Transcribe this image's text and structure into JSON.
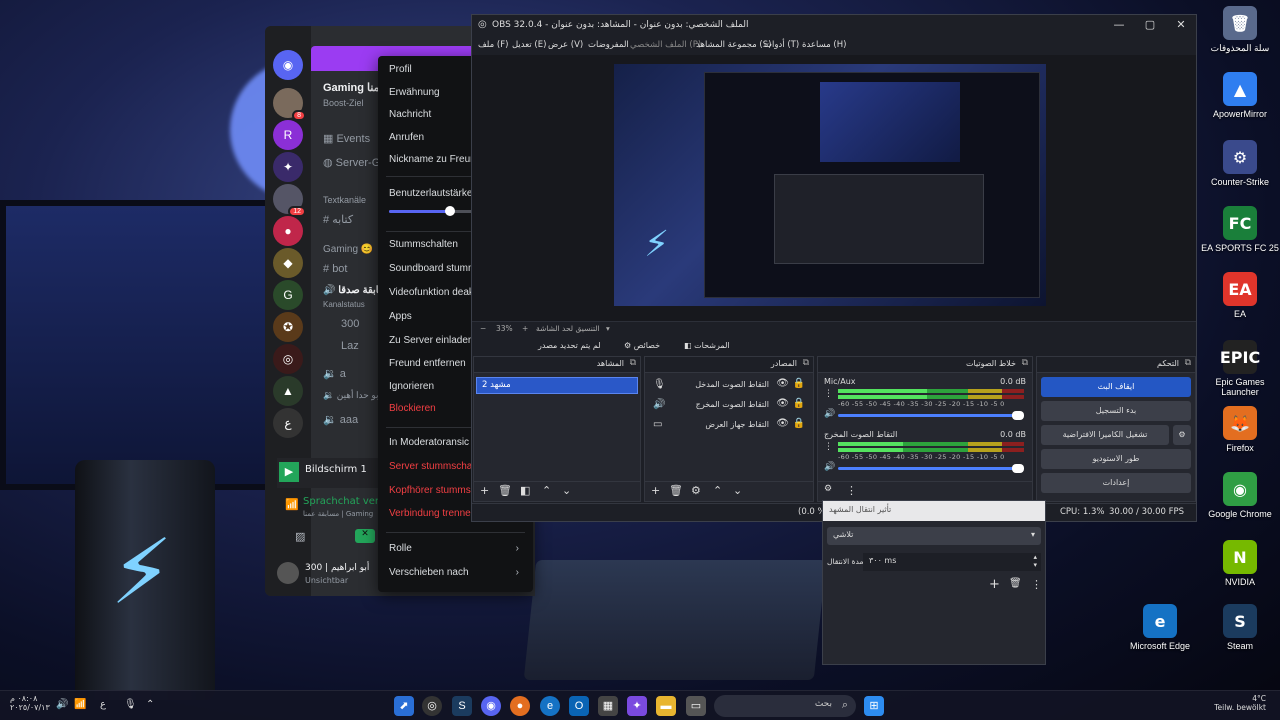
{
  "desktop": {
    "icons": [
      {
        "label": "سلة المحذوفات",
        "glyph": "🗑",
        "color": "#5a6a8c"
      },
      {
        "label": "ApowerMirror",
        "glyph": "▲",
        "color": "#2f7ef0"
      },
      {
        "label": "Counter-Strike",
        "glyph": "⚙",
        "color": "#3a4a8c"
      },
      {
        "label": "EA SPORTS FC 25",
        "glyph": "FC",
        "color": "#1a7f3a"
      },
      {
        "label": "EA",
        "glyph": "EA",
        "color": "#e0352b"
      },
      {
        "label": "Epic Games Launcher",
        "glyph": "EPIC",
        "color": "#222"
      },
      {
        "label": "Firefox",
        "glyph": "🦊",
        "color": "#e36e20"
      },
      {
        "label": "Google Chrome",
        "glyph": "◉",
        "color": "#2f9e44"
      },
      {
        "label": "NVIDIA",
        "glyph": "N",
        "color": "#76b900"
      },
      {
        "label": "Microsoft Edge",
        "glyph": "e",
        "color": "#1572c4"
      },
      {
        "label": "Steam",
        "glyph": "S",
        "color": "#1b3b5e"
      }
    ]
  },
  "discord": {
    "server_name": "Gaming صدقة عمنا",
    "boost_label": "Boost-Ziel",
    "channels": [
      "Events",
      "Server-G",
      "Textkanäle",
      "كتابه",
      "Gaming 😊",
      "bot",
      "مسابقة صدقا",
      "Kanalstatus",
      "300",
      "Laz",
      "a",
      "أبو حدا أهين",
      "aaa"
    ],
    "voice_user": "Bildschirm 1",
    "voice_status": "Sprachchat verb",
    "voice_server": "مسابقة عمنا | Gaming",
    "user_name": "أبو ابراهيم | 300",
    "user_status": "Unsichtbar",
    "badges": [
      "8",
      "12"
    ]
  },
  "context_menu": {
    "items": [
      {
        "label": "Profil",
        "red": false
      },
      {
        "label": "Erwähnung",
        "red": false
      },
      {
        "label": "Nachricht",
        "red": false
      },
      {
        "label": "Anrufen",
        "red": false
      },
      {
        "label": "Nickname zu Freund",
        "red": false
      },
      {
        "label": "Benutzerlautstärke",
        "red": false
      },
      {
        "label": "Stummschalten",
        "red": false
      },
      {
        "label": "Soundboard stumm",
        "red": false
      },
      {
        "label": "Videofunktion deakt",
        "red": false
      },
      {
        "label": "Apps",
        "red": false
      },
      {
        "label": "Zu Server einladen",
        "red": false
      },
      {
        "label": "Freund entfernen",
        "red": false
      },
      {
        "label": "Ignorieren",
        "red": false
      },
      {
        "label": "Blockieren",
        "red": true
      },
      {
        "label": "In Moderatoransic",
        "red": false
      },
      {
        "label": "Server stummschalt",
        "red": true
      },
      {
        "label": "Kopfhörer stummsch",
        "red": true
      },
      {
        "label": "Verbindung trennen",
        "red": true
      },
      {
        "label": "Rolle",
        "red": false
      },
      {
        "label": "Verschieben nach",
        "red": false
      }
    ],
    "volume_level": 0.55
  },
  "obs": {
    "title": "OBS 32.0.4 - الملف الشخصي: بدون عنوان - المشاهد: بدون عنوان",
    "menu": [
      "ملف (F)",
      "تعديل (E)",
      "عرض (V)",
      "المفروضات",
      "الملف الشخصي (P)",
      "مجموعة المشاهد (S)",
      "أدوات (T)",
      "مساعدة (H)"
    ],
    "zoom": "33%",
    "zoom_hint": "التنسيق لحد الشاشة",
    "toolbar": {
      "no_source": "لم يتم تحديد مصدر",
      "properties": "خصائص",
      "filters": "المرشحات"
    },
    "docks": {
      "scenes": "المشاهد",
      "sources": "المصادر",
      "mixer": "خلاط الصوتيات",
      "controls": "التحكم"
    },
    "scene_selected": "مشهد 2",
    "sources": [
      {
        "name": "التقاط الصوت المدخل",
        "icon": "🎙"
      },
      {
        "name": "التقاط الصوت المخرج",
        "icon": "🔊"
      },
      {
        "name": "التقاط جهاز العرض",
        "icon": "▭"
      }
    ],
    "mixer": [
      {
        "name": "Mic/Aux",
        "db": "0.0 dB",
        "level": 0.48
      },
      {
        "name": "التقاط الصوت المخرج",
        "db": "0.0 dB",
        "level": 0.35
      }
    ],
    "mixer_scale": "-60 -55 -50 -45 -40 -35 -30 -25 -20 -15 -10 -5 0",
    "controls": [
      "ايقاف البث",
      "بدء التسجيل",
      "تشغيل الكاميرا الافتراضية",
      "طور الاستوديو",
      "إعدادات"
    ],
    "status": {
      "cpu": "CPU: 1.3%",
      "fps": "30.00 / 30.00 FPS",
      "partial": "(0.0 %"
    },
    "transition": {
      "header": "تأثير انتقال المشهد",
      "selected": "تلاشي",
      "duration_label": "مدة الانتقال",
      "duration_value": "٣٠٠ ms"
    }
  },
  "taskbar": {
    "search_placeholder": "بحث",
    "time": "٠٨:٠٨ م",
    "date": "٢٠٢٥/٠٧/١٣",
    "lang": "ع",
    "weather_temp": "4°C",
    "weather_text": "Teilw. bewölkt"
  }
}
